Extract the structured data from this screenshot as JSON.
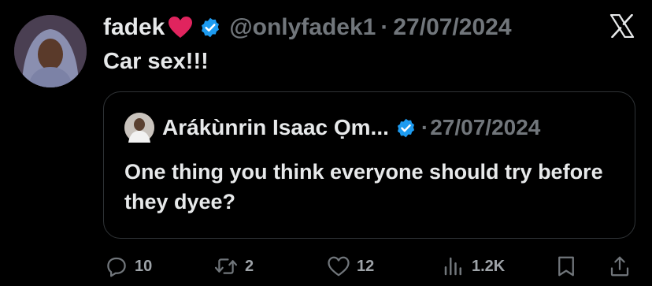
{
  "tweet": {
    "author_name": "fadek",
    "author_handle": "@onlyfadek1",
    "separator": "·",
    "date": "27/07/2024",
    "text": "Car sex!!!",
    "verified": true
  },
  "quote": {
    "author_name": "Arákùnrin Isaac Ọm...",
    "separator": "·",
    "date": "27/07/2024",
    "text": "One thing you think everyone should try before they dyee?",
    "verified": true
  },
  "actions": {
    "replies": "10",
    "retweets": "2",
    "likes": "12",
    "views": "1.2K"
  },
  "colors": {
    "background": "#000000",
    "text_primary": "#e7e9ea",
    "text_secondary": "#71767b",
    "verified_blue": "#1d9bf0",
    "heart_red": "#e0245e",
    "border": "#2f3336"
  },
  "icons": [
    "heart-icon",
    "verified-badge-icon",
    "x-logo-icon",
    "reply-icon",
    "retweet-icon",
    "like-icon",
    "views-icon",
    "bookmark-icon",
    "share-icon"
  ]
}
